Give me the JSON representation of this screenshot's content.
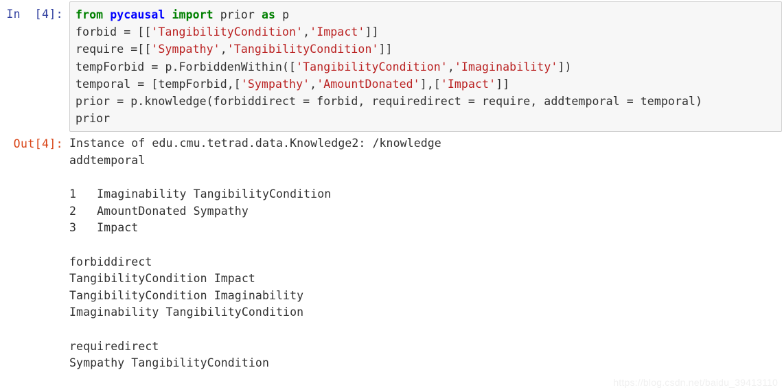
{
  "cell": {
    "input_prompt": "In  [4]:",
    "output_prompt": "Out[4]:",
    "code_lines": [
      {
        "tokens": [
          {
            "t": "kw",
            "s": "from"
          },
          {
            "t": "txt",
            "s": " "
          },
          {
            "t": "mod",
            "s": "pycausal"
          },
          {
            "t": "txt",
            "s": " "
          },
          {
            "t": "kw",
            "s": "import"
          },
          {
            "t": "txt",
            "s": " prior "
          },
          {
            "t": "kw",
            "s": "as"
          },
          {
            "t": "txt",
            "s": " p"
          }
        ]
      },
      {
        "tokens": [
          {
            "t": "txt",
            "s": "forbid = [["
          },
          {
            "t": "str",
            "s": "'TangibilityCondition'"
          },
          {
            "t": "txt",
            "s": ","
          },
          {
            "t": "str",
            "s": "'Impact'"
          },
          {
            "t": "txt",
            "s": "]]"
          }
        ]
      },
      {
        "tokens": [
          {
            "t": "txt",
            "s": "require =[["
          },
          {
            "t": "str",
            "s": "'Sympathy'"
          },
          {
            "t": "txt",
            "s": ","
          },
          {
            "t": "str",
            "s": "'TangibilityCondition'"
          },
          {
            "t": "txt",
            "s": "]]"
          }
        ]
      },
      {
        "tokens": [
          {
            "t": "txt",
            "s": "tempForbid = p.ForbiddenWithin(["
          },
          {
            "t": "str",
            "s": "'TangibilityCondition'"
          },
          {
            "t": "txt",
            "s": ","
          },
          {
            "t": "str",
            "s": "'Imaginability'"
          },
          {
            "t": "txt",
            "s": "])"
          }
        ]
      },
      {
        "tokens": [
          {
            "t": "txt",
            "s": "temporal = [tempForbid,["
          },
          {
            "t": "str",
            "s": "'Sympathy'"
          },
          {
            "t": "txt",
            "s": ","
          },
          {
            "t": "str",
            "s": "'AmountDonated'"
          },
          {
            "t": "txt",
            "s": "],["
          },
          {
            "t": "str",
            "s": "'Impact'"
          },
          {
            "t": "txt",
            "s": "]]"
          }
        ]
      },
      {
        "tokens": [
          {
            "t": "txt",
            "s": "prior = p.knowledge(forbiddirect = forbid, requiredirect = require, addtemporal = temporal)"
          }
        ]
      },
      {
        "tokens": [
          {
            "t": "txt",
            "s": "prior"
          }
        ]
      }
    ],
    "output_lines": [
      "Instance of edu.cmu.tetrad.data.Knowledge2: /knowledge",
      "addtemporal",
      "",
      "1   Imaginability TangibilityCondition",
      "2   AmountDonated Sympathy",
      "3   Impact",
      "",
      "forbiddirect",
      "TangibilityCondition Impact",
      "TangibilityCondition Imaginability",
      "Imaginability TangibilityCondition",
      "",
      "requiredirect",
      "Sympathy TangibilityCondition"
    ]
  },
  "watermark": {
    "text": "https://blog.csdn.net/baidu_39413110"
  },
  "colors": {
    "keyword": "#008000",
    "module": "#0000ff",
    "string": "#ba2121",
    "plain": "#303030",
    "in_prompt": "#303f9f",
    "out_prompt": "#d84315",
    "cell_bg": "#f7f7f7",
    "cell_border": "#cfcfcf",
    "page_bg": "#ffffff"
  }
}
